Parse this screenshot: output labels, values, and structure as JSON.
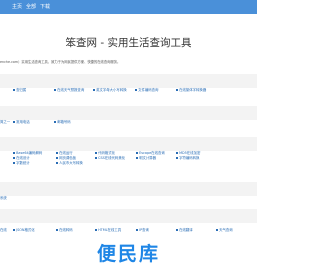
{
  "nav": {
    "home": "主页",
    "all": "全部",
    "download": "下载"
  },
  "site_title": "笨查网 - 实用生活查询工具",
  "intro": "enche.com）实用生活查询工具，致力于为网民提供方便、快捷的在线查询服务。",
  "row1": [
    "查归属",
    "在线天气预报查询",
    "英文字母大小写转换",
    "文件编码查询",
    "在线繁体字转换器"
  ],
  "row2": [
    "简之一",
    "常用电话",
    "邮箱号码"
  ],
  "row3": [
    [
      "Base64编码解码",
      "在线运行",
      "代码格式化",
      "Escape在线查询",
      "MD5在线加密"
    ],
    [
      "在线设计",
      "网页调色板",
      "CSS在线代码美化",
      "明文计算器",
      "字符编码转换"
    ],
    [
      "字数统计",
      "人民币大写转换"
    ]
  ],
  "row4": [
    "系统"
  ],
  "row5": [
    "在线",
    "JSON格式化",
    "在线转码",
    "HTML在线工具",
    "IP查询",
    "在线翻译",
    "天气查询"
  ],
  "brand": "便民库"
}
